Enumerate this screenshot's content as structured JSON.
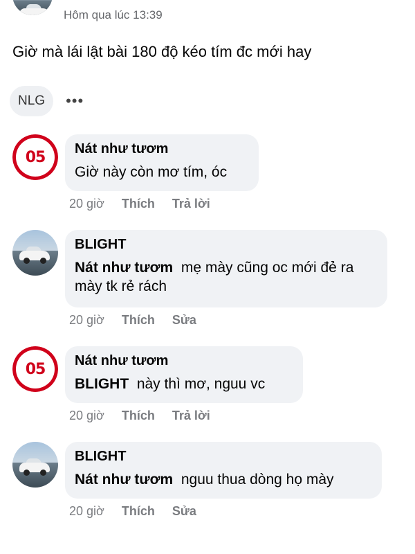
{
  "post": {
    "time": "Hôm qua lúc 13:39",
    "text": "Giờ mà lái lật bài 180 độ kéo tím đc mới hay"
  },
  "reaction": {
    "chip": "NLG",
    "more": "•••"
  },
  "comments": [
    {
      "author": "Nát như tươm",
      "tag": "",
      "text": "Giờ này còn mơ tím, óc",
      "time": "20 giờ",
      "like": "Thích",
      "action": "Trả lời",
      "avatar": "mainz-05-logo"
    },
    {
      "author": "BLIGHT",
      "tag": "Nát như tươm",
      "text": "mẹ mày cũng oc mới đẻ ra mày tk rẻ rách",
      "time": "20 giờ",
      "like": "Thích",
      "action": "Sửa",
      "avatar": "car-photo"
    },
    {
      "author": "Nát như tươm",
      "tag": "BLIGHT",
      "text": "này thì mơ, nguu vc",
      "time": "20 giờ",
      "like": "Thích",
      "action": "Trả lời",
      "avatar": "mainz-05-logo"
    },
    {
      "author": "BLIGHT",
      "tag": "Nát như tươm",
      "text": "nguu thua dòng họ mày",
      "time": "20 giờ",
      "like": "Thích",
      "action": "Sửa",
      "avatar": "car-photo"
    }
  ],
  "logo_text": "05",
  "colors": {
    "bubble": "#f0f2f5",
    "meta": "#7a7c80",
    "logo_red": "#d0021b"
  }
}
